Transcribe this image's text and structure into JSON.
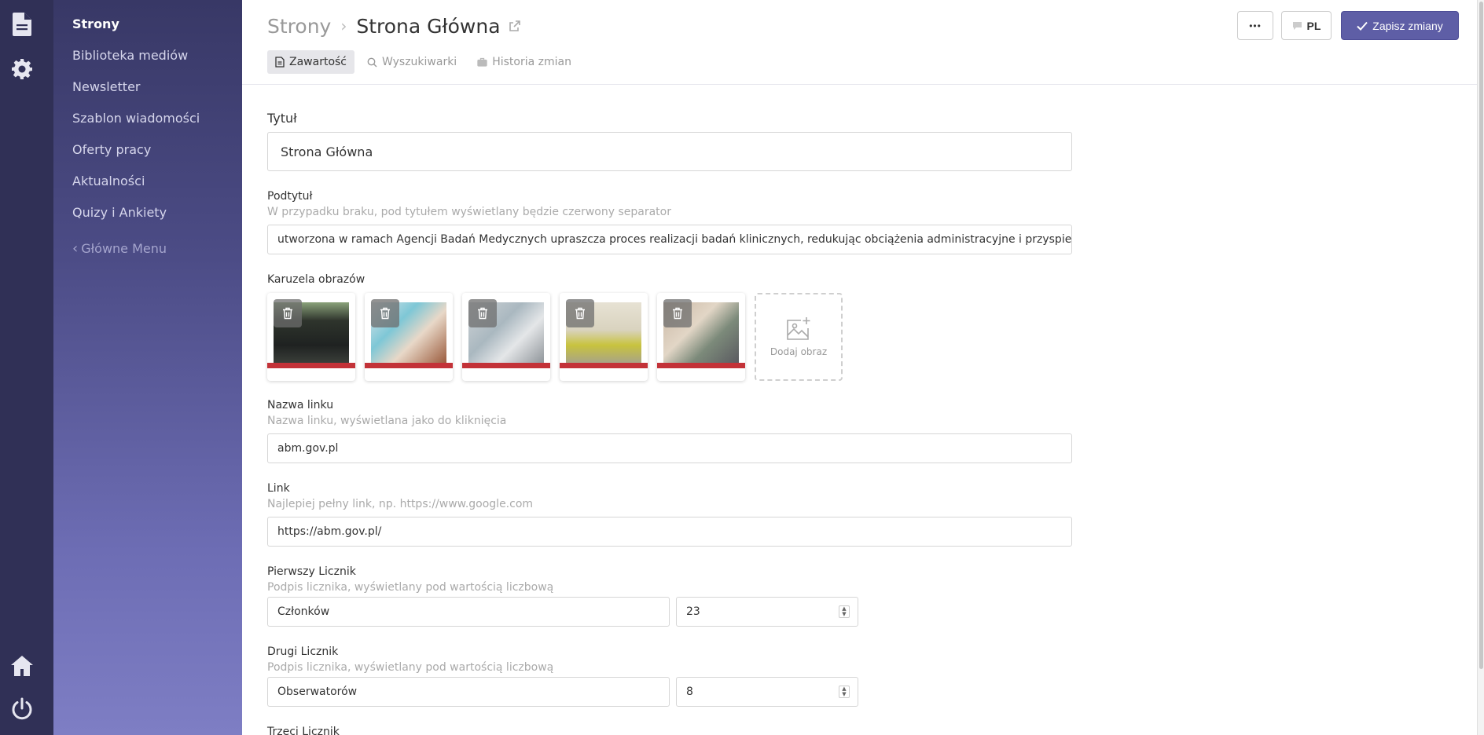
{
  "rail": {
    "top_icons": [
      "document-icon",
      "gear-icon"
    ],
    "bottom_icons": [
      "home-icon",
      "power-icon"
    ]
  },
  "sidebar": {
    "items": [
      {
        "label": "Strony",
        "active": true
      },
      {
        "label": "Biblioteka mediów"
      },
      {
        "label": "Newsletter"
      },
      {
        "label": "Szablon wiadomości"
      },
      {
        "label": "Oferty pracy"
      },
      {
        "label": "Aktualności"
      },
      {
        "label": "Quizy i Ankiety"
      }
    ],
    "back_label": "Główne Menu"
  },
  "header": {
    "breadcrumb_parent": "Strony",
    "breadcrumb_current": "Strona Główna",
    "tabs": [
      {
        "label": "Zawartość",
        "icon": "file-icon",
        "active": true
      },
      {
        "label": "Wyszukiwarki",
        "icon": "search-icon"
      },
      {
        "label": "Historia zmian",
        "icon": "briefcase-icon"
      }
    ],
    "more_label": "•••",
    "lang_label": "PL",
    "save_label": "Zapisz zmiany"
  },
  "form": {
    "title_label": "Tytuł",
    "title_value": "Strona Główna",
    "subtitle_label": "Podtytuł",
    "subtitle_hint": "W przypadku braku, pod tytułem wyświetlany będzie czerwony separator",
    "subtitle_value": "utworzona w ramach Agencji Badań Medycznych upraszcza proces realizacji badań klinicznych, redukując obciążenia administracyjne i przyspieszając",
    "carousel_label": "Karuzela obrazów",
    "carousel_add_label": "Dodaj obraz",
    "link_name_label": "Nazwa linku",
    "link_name_hint": "Nazwa linku, wyświetlana jako do kliknięcia",
    "link_name_value": "abm.gov.pl",
    "link_label": "Link",
    "link_hint": "Najlepiej pełny link, np. https://www.google.com",
    "link_value": "https://abm.gov.pl/",
    "counter1_label": "Pierwszy Licznik",
    "counter1_hint": "Podpis licznika, wyświetlany pod wartością liczbową",
    "counter1_caption": "Członków",
    "counter1_value": "23",
    "counter2_label": "Drugi Licznik",
    "counter2_hint": "Podpis licznika, wyświetlany pod wartością liczbową",
    "counter2_caption": "Obserwatorów",
    "counter2_value": "8",
    "counter3_label": "Trzeci Licznik"
  },
  "colors": {
    "accent": "#5e5ea6",
    "rail": "#303056",
    "separator_red": "#c33238"
  }
}
